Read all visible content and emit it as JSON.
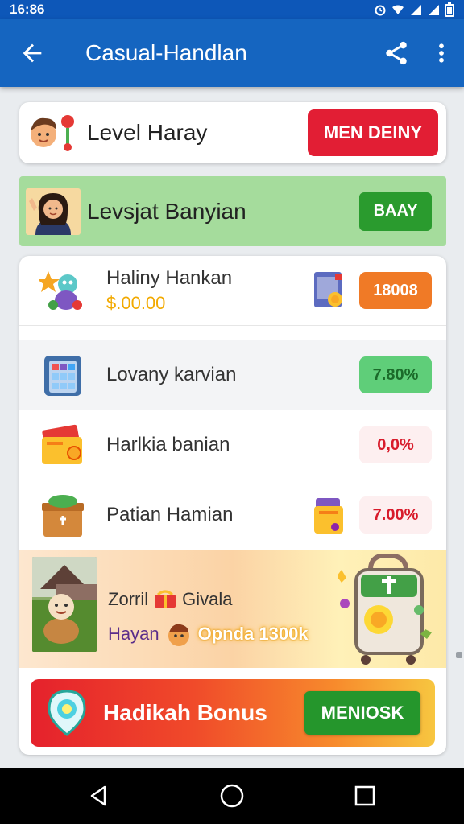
{
  "status_bar": {
    "time": "16:86",
    "icons": [
      "alarm-icon",
      "wifi-icon",
      "signal-icon",
      "signal-icon",
      "battery-icon"
    ]
  },
  "app_bar": {
    "title": "Casual-Handlan",
    "back_icon": "arrow-left-icon",
    "share_icon": "share-icon",
    "menu_icon": "more-vert-icon"
  },
  "level_card": {
    "title": "Level Haray",
    "button_label": "MEN DEINY"
  },
  "green_card": {
    "title": "Levsjat Banyian",
    "button_label": "BAAY"
  },
  "list": [
    {
      "label": "Haliny Hankan",
      "sub": "$.00.00",
      "badge": "18008",
      "badge_bg": "#f07a26",
      "badge_fg": "#ffffff"
    },
    {
      "label": "Lovany karvian",
      "sub": "",
      "badge": "7.80%",
      "badge_bg": "#5fce79",
      "badge_fg": "#1b6b2a"
    },
    {
      "label": "Harlkia banian",
      "sub": "",
      "badge": "0,0%",
      "badge_bg": "#fdeff0",
      "badge_fg": "#d81b2b"
    },
    {
      "label": "Patian Hamian",
      "sub": "",
      "badge": "7.00%",
      "badge_bg": "#fdeff0",
      "badge_fg": "#d81b2b"
    }
  ],
  "promo": {
    "line1_a": "Zorril",
    "line1_b": "Givala",
    "line2_a": "Hayan",
    "line2_b": "Opnda 1300k"
  },
  "bonus": {
    "title": "Hadikah Bonus",
    "button_label": "MENIOSK"
  },
  "colors": {
    "app_bar": "#1565c0",
    "accent_red": "#e21e34",
    "accent_green": "#2a9b2e",
    "green_card": "#a5dc9c"
  }
}
